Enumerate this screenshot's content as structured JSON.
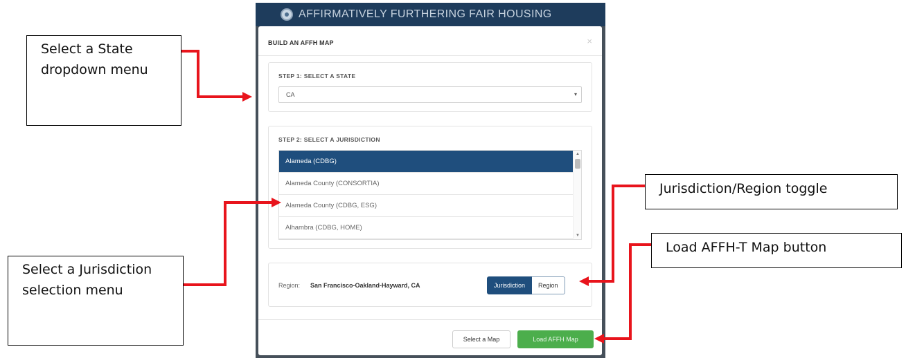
{
  "app": {
    "title": "AFFIRMATIVELY FURTHERING FAIR HOUSING"
  },
  "modal": {
    "title": "BUILD AN AFFH MAP",
    "close_glyph": "×",
    "step1": {
      "label": "STEP 1: SELECT A STATE",
      "selected_value": "CA",
      "caret": "▾"
    },
    "step2": {
      "label": "STEP 2: SELECT A JURISDICTION",
      "items": [
        {
          "label": "Alameda (CDBG)",
          "selected": true
        },
        {
          "label": "Alameda County (CONSORTIA)",
          "selected": false
        },
        {
          "label": "Alameda County (CDBG, ESG)",
          "selected": false
        },
        {
          "label": "Alhambra (CDBG, HOME)",
          "selected": false
        }
      ],
      "scroll_up": "▲",
      "scroll_down": "▼"
    },
    "region": {
      "label": "Region:",
      "value": "San Francisco-Oakland-Hayward, CA",
      "toggle": {
        "jurisdiction_label": "Jurisdiction",
        "region_label": "Region",
        "active": "Jurisdiction"
      }
    },
    "footer": {
      "select_map_label": "Select a Map",
      "load_map_label": "Load AFFH Map"
    }
  },
  "callouts": {
    "state_dropdown": "Select a State dropdown menu",
    "jurisdiction_menu": "Select a Jurisdiction selection menu",
    "toggle": "Jurisdiction/Region toggle",
    "load_button": "Load AFFH-T Map button"
  },
  "colors": {
    "accent": "#1f4e7d",
    "success": "#4cae4c",
    "arrow": "#e8141c",
    "header": "#1e3c5c"
  },
  "icons": {
    "seal": "hud-seal-icon"
  }
}
